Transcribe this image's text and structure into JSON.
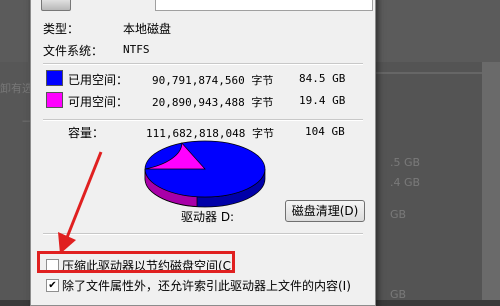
{
  "background": {
    "left_text": "卸有选",
    "left_text2": "—",
    "right_values": [
      ".5 GB",
      ".4 GB",
      "GB",
      "GB"
    ],
    "right_button": "□"
  },
  "general": {
    "type_label": "类型：",
    "type_value": "本地磁盘",
    "fs_label": "文件系统：",
    "fs_value": "NTFS"
  },
  "usage": {
    "used_label": "已用空间：",
    "used_bytes": "90,791,874,560 字节",
    "used_size": "84.5 GB",
    "used_color": "#0000ff",
    "free_label": "可用空间：",
    "free_bytes": "20,890,943,488 字节",
    "free_size": "19.4 GB",
    "free_color": "#ff00ff",
    "capacity_label": "容量：",
    "capacity_bytes": "111,682,818,048 字节",
    "capacity_size": "104 GB",
    "used_fraction": 0.813
  },
  "drive": {
    "label": "驱动器 D:",
    "cleanup_button": "磁盘清理(D)"
  },
  "options": {
    "compress_label": "压缩此驱动器以节约磁盘空间(C)",
    "compress_checked": false,
    "index_label": "除了文件属性外，还允许索引此驱动器上文件的内容(I)",
    "index_checked": true,
    "index_mark": "✔"
  },
  "annotation": {
    "highlight_color": "#e02020"
  }
}
